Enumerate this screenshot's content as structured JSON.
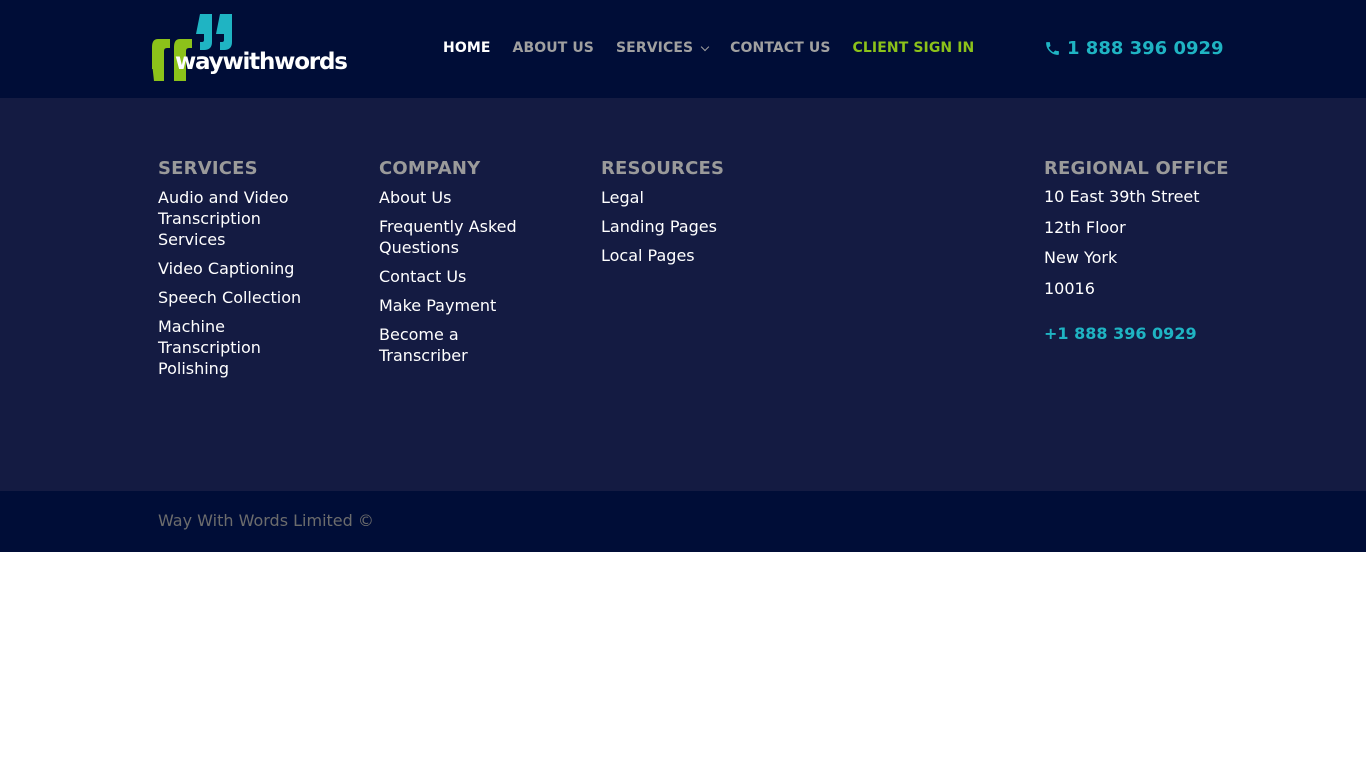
{
  "header": {
    "logo_text": "waywithwords",
    "logo_colors": {
      "green": "#8cc21a",
      "teal": "#1fb4c3"
    },
    "nav": [
      {
        "label": "HOME",
        "active": true
      },
      {
        "label": "ABOUT US"
      },
      {
        "label": "SERVICES",
        "has_dropdown": true
      },
      {
        "label": "CONTACT US"
      },
      {
        "label": "CLIENT SIGN IN",
        "highlight": "#8cc21a"
      }
    ],
    "phone": {
      "icon": "phone-icon",
      "label": "1 888 396 0929"
    }
  },
  "footer": {
    "columns": {
      "services": {
        "title": "SERVICES",
        "links": [
          "Audio and Video Transcription Services",
          "Video Captioning",
          "Speech Collection",
          "Machine Transcription Polishing"
        ]
      },
      "company": {
        "title": "COMPANY",
        "links": [
          "About Us",
          "Frequently Asked Questions",
          "Contact Us",
          "Make Payment",
          "Become a Transcriber"
        ]
      },
      "resources": {
        "title": "RESOURCES",
        "links": [
          "Legal",
          "Landing Pages",
          "Local Pages"
        ]
      },
      "office": {
        "title": "REGIONAL OFFICE",
        "lines": [
          "10 East 39th Street",
          "12th Floor",
          "New York",
          "10016"
        ],
        "phone": "+1 888 396 0929"
      }
    },
    "copyright": "Way With Words Limited ©"
  },
  "colors": {
    "header_bg": "#000d37",
    "footer_bg": "#141b42",
    "accent_teal": "#1fb4c3",
    "accent_green": "#8cc21a",
    "heading_gray": "#9a9a9a"
  }
}
